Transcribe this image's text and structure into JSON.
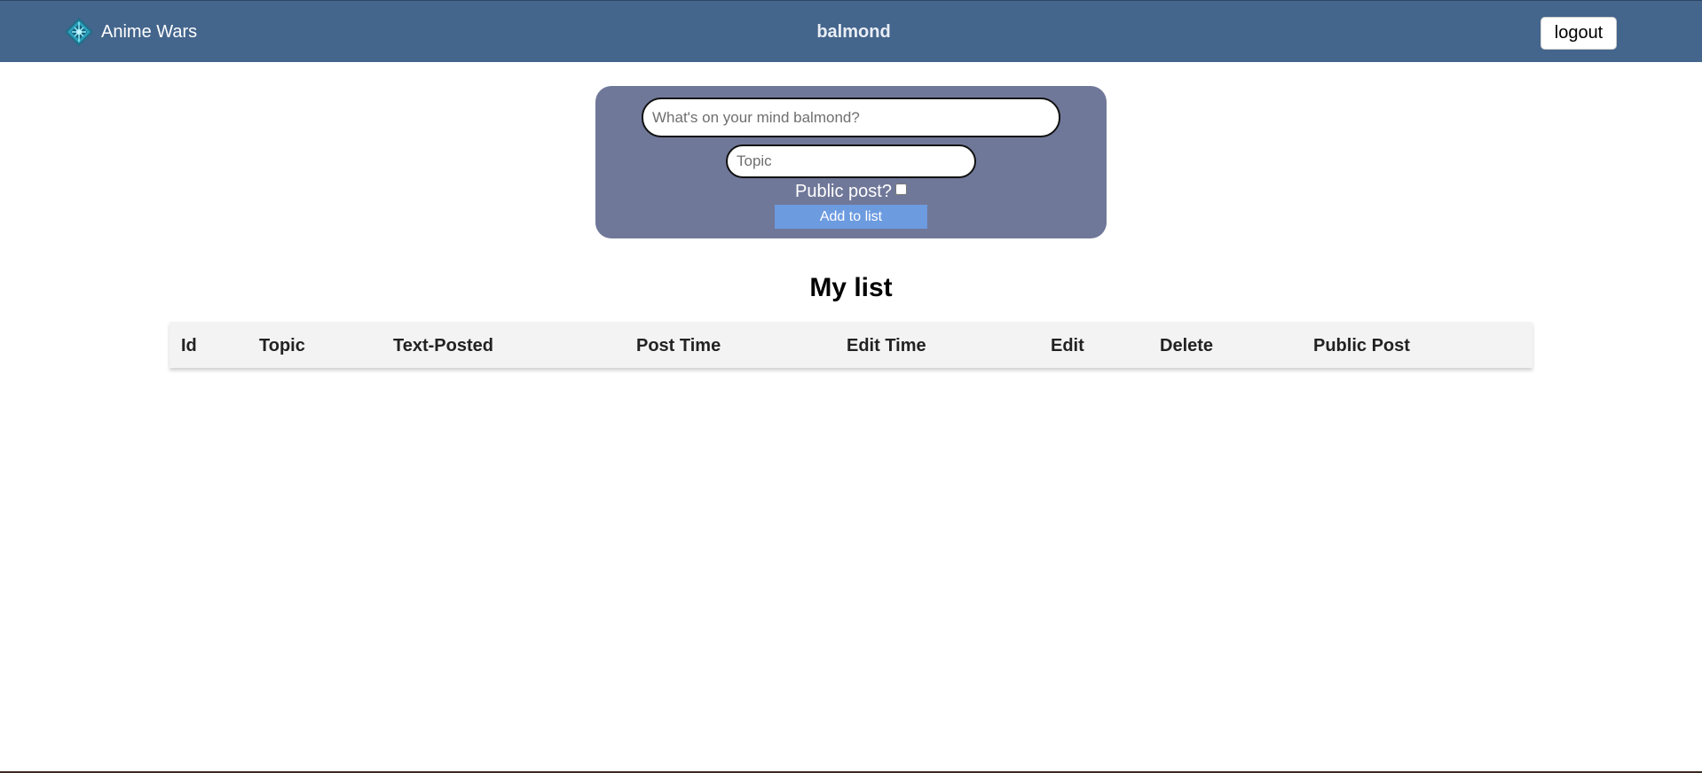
{
  "header": {
    "app_name": "Anime Wars",
    "username": "balmond",
    "logout_label": "logout",
    "logo_icon": "diamond-logo-icon",
    "background_color": "#44658c"
  },
  "post_form": {
    "text_placeholder": "What's on your mind balmond?",
    "text_value": "",
    "topic_placeholder": "Topic",
    "topic_value": "",
    "public_label": "Public post?",
    "public_checked": false,
    "add_button_label": "Add to list",
    "card_color": "#707899",
    "button_color": "#6c9be0"
  },
  "list": {
    "title": "My list",
    "columns": [
      "Id",
      "Topic",
      "Text-Posted",
      "Post Time",
      "Edit Time",
      "Edit",
      "Delete",
      "Public Post"
    ],
    "rows": []
  }
}
